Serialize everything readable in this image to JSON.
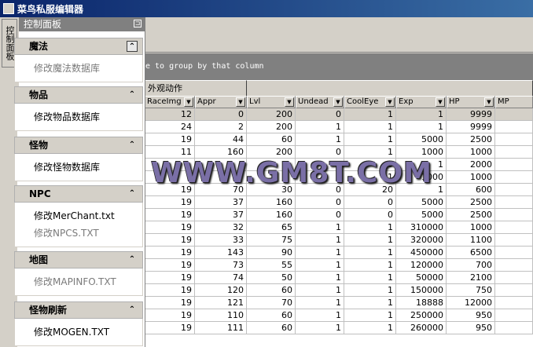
{
  "window": {
    "title": "菜鸟私服编辑器"
  },
  "side_tab": {
    "label": "控制面板"
  },
  "panel": {
    "title": "控制面板",
    "pin": "⊐",
    "groups": [
      {
        "title": "魔法",
        "chevron": "⌃",
        "boxed": true,
        "links": [
          {
            "label": "修改魔法数据库",
            "muted": true
          }
        ]
      },
      {
        "title": "物品",
        "chevron": "⌃",
        "boxed": false,
        "links": [
          {
            "label": "修改物品数据库",
            "muted": false
          }
        ]
      },
      {
        "title": "怪物",
        "chevron": "⌃",
        "boxed": false,
        "links": [
          {
            "label": "修改怪物数据库",
            "muted": false
          }
        ]
      },
      {
        "title": "NPC",
        "chevron": "⌃",
        "boxed": false,
        "links": [
          {
            "label": "修改MerChant.txt",
            "muted": false
          },
          {
            "label": "修改NPCS.TXT",
            "muted": true
          }
        ]
      },
      {
        "title": "地图",
        "chevron": "⌃",
        "boxed": false,
        "links": [
          {
            "label": "修改MAPINFO.TXT",
            "muted": true
          }
        ]
      },
      {
        "title": "怪物刷新",
        "chevron": "⌃",
        "boxed": false,
        "links": [
          {
            "label": "修改MOGEN.TXT",
            "muted": false
          }
        ]
      }
    ]
  },
  "grid": {
    "group_hint": "e to group by that column",
    "band_label": "外观动作",
    "columns": [
      "RaceImg",
      "Appr",
      "Lvl",
      "Undead",
      "CoolEye",
      "Exp",
      "HP",
      "MP"
    ],
    "rows": [
      [
        "12",
        "0",
        "200",
        "0",
        "1",
        "1",
        "9999",
        ""
      ],
      [
        "24",
        "2",
        "200",
        "1",
        "1",
        "1",
        "9999",
        ""
      ],
      [
        "19",
        "44",
        "60",
        "1",
        "1",
        "5000",
        "2500",
        ""
      ],
      [
        "11",
        "160",
        "200",
        "0",
        "1",
        "1000",
        "1000",
        ""
      ],
      [
        "",
        "",
        "",
        "",
        "0",
        "1",
        "2000",
        ""
      ],
      [
        "",
        "",
        "",
        "",
        "1",
        "1000",
        "1000",
        ""
      ],
      [
        "19",
        "70",
        "30",
        "0",
        "20",
        "1",
        "600",
        ""
      ],
      [
        "19",
        "37",
        "160",
        "0",
        "0",
        "5000",
        "2500",
        ""
      ],
      [
        "19",
        "37",
        "160",
        "0",
        "0",
        "5000",
        "2500",
        ""
      ],
      [
        "19",
        "32",
        "65",
        "1",
        "1",
        "310000",
        "1000",
        ""
      ],
      [
        "19",
        "33",
        "75",
        "1",
        "1",
        "320000",
        "1100",
        ""
      ],
      [
        "19",
        "143",
        "90",
        "1",
        "1",
        "450000",
        "6500",
        ""
      ],
      [
        "19",
        "73",
        "55",
        "1",
        "1",
        "120000",
        "700",
        ""
      ],
      [
        "19",
        "74",
        "50",
        "1",
        "1",
        "50000",
        "2100",
        ""
      ],
      [
        "19",
        "120",
        "60",
        "1",
        "1",
        "150000",
        "750",
        ""
      ],
      [
        "19",
        "121",
        "70",
        "1",
        "1",
        "18888",
        "12000",
        ""
      ],
      [
        "19",
        "110",
        "60",
        "1",
        "1",
        "250000",
        "950",
        ""
      ],
      [
        "19",
        "111",
        "60",
        "1",
        "1",
        "260000",
        "950",
        ""
      ]
    ]
  },
  "watermark": "WWW.GM8T.COM",
  "icons": {
    "dropdown": "dropdown-arrow-icon",
    "pin": "pin-icon",
    "collapse": "chevron-up-icon"
  }
}
